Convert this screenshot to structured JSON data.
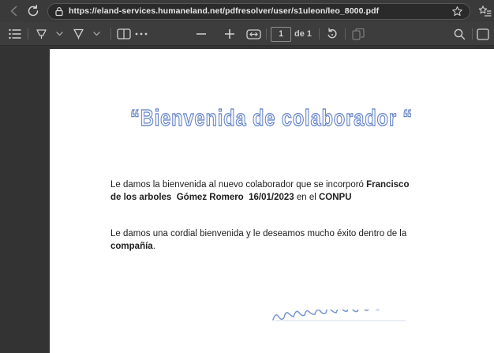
{
  "browser": {
    "url": "https://eland-services.humaneland.net/pdfresolver/user/s1uleon/leo_8000.pdf"
  },
  "pdf_toolbar": {
    "page_number": "1",
    "page_count_label": "de 1"
  },
  "document": {
    "title": "“Bienvenida de colaborador “",
    "paragraph1": {
      "segments": [
        {
          "text": "Le damos la bienvenida al nuevo colaborador que se incorporó ",
          "bold": false
        },
        {
          "text": "Francisco de los arboles  Gómez Romero  16/01/2023",
          "bold": true
        },
        {
          "text": " en el ",
          "bold": false
        },
        {
          "text": "CONPU",
          "bold": true
        }
      ]
    },
    "paragraph2": {
      "segments": [
        {
          "text": "Le damos una cordial bienvenida y le deseamos mucho éxito dentro de la ",
          "bold": false
        },
        {
          "text": "compañía",
          "bold": true
        },
        {
          "text": ".",
          "bold": false
        }
      ]
    }
  },
  "colors": {
    "title_outline_blue": "#5b7cc5",
    "title_fill": "#f2f5fc",
    "scribble_blue": "#6f8fce",
    "chrome_dark": "#3a3a3a",
    "page_white": "#ffffff"
  }
}
